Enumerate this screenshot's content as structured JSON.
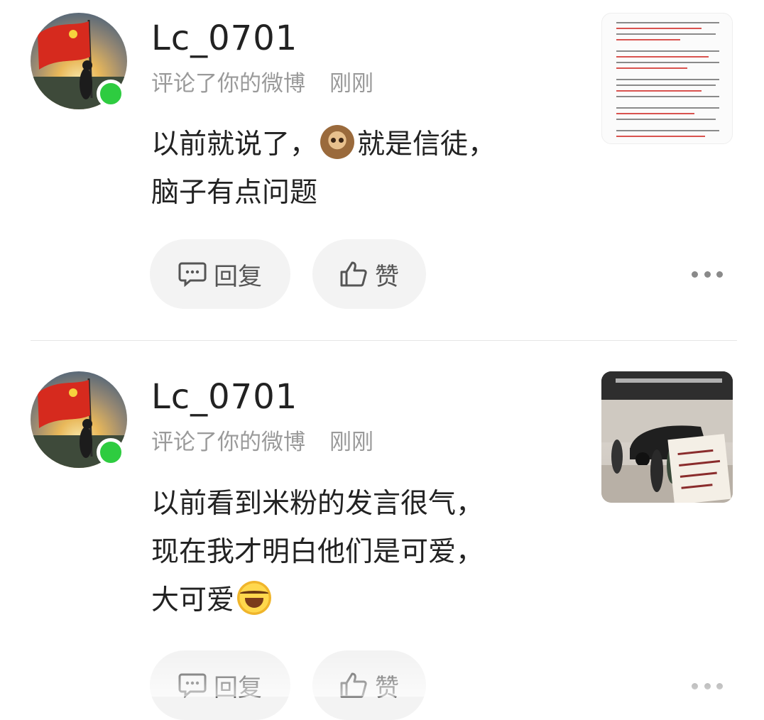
{
  "comments": [
    {
      "username": "Lc_0701",
      "action": "评论了你的微博",
      "time": "刚刚",
      "text_line1": "以前就说了，",
      "text_line1_after_emoji": "就是信徒，",
      "text_line2": "脑子有点问题",
      "emoji": "monkey-emoji",
      "reply_label": "回复",
      "like_label": "赞",
      "thumbnail": "document-screenshot"
    },
    {
      "username": "Lc_0701",
      "action": "评论了你的微博",
      "time": "刚刚",
      "text_line1": "以前看到米粉的发言很气，",
      "text_line2": "现在我才明白他们是可爱，",
      "text_line3": "大可爱",
      "emoji": "laughing-tears-emoji",
      "reply_label": "回复",
      "like_label": "赞",
      "thumbnail": "car-showroom-photo"
    }
  ],
  "colors": {
    "online": "#2ecc40",
    "meta_text": "#9a9a9a",
    "pill_bg": "#f3f3f3",
    "flag_red": "#d62a1e"
  }
}
